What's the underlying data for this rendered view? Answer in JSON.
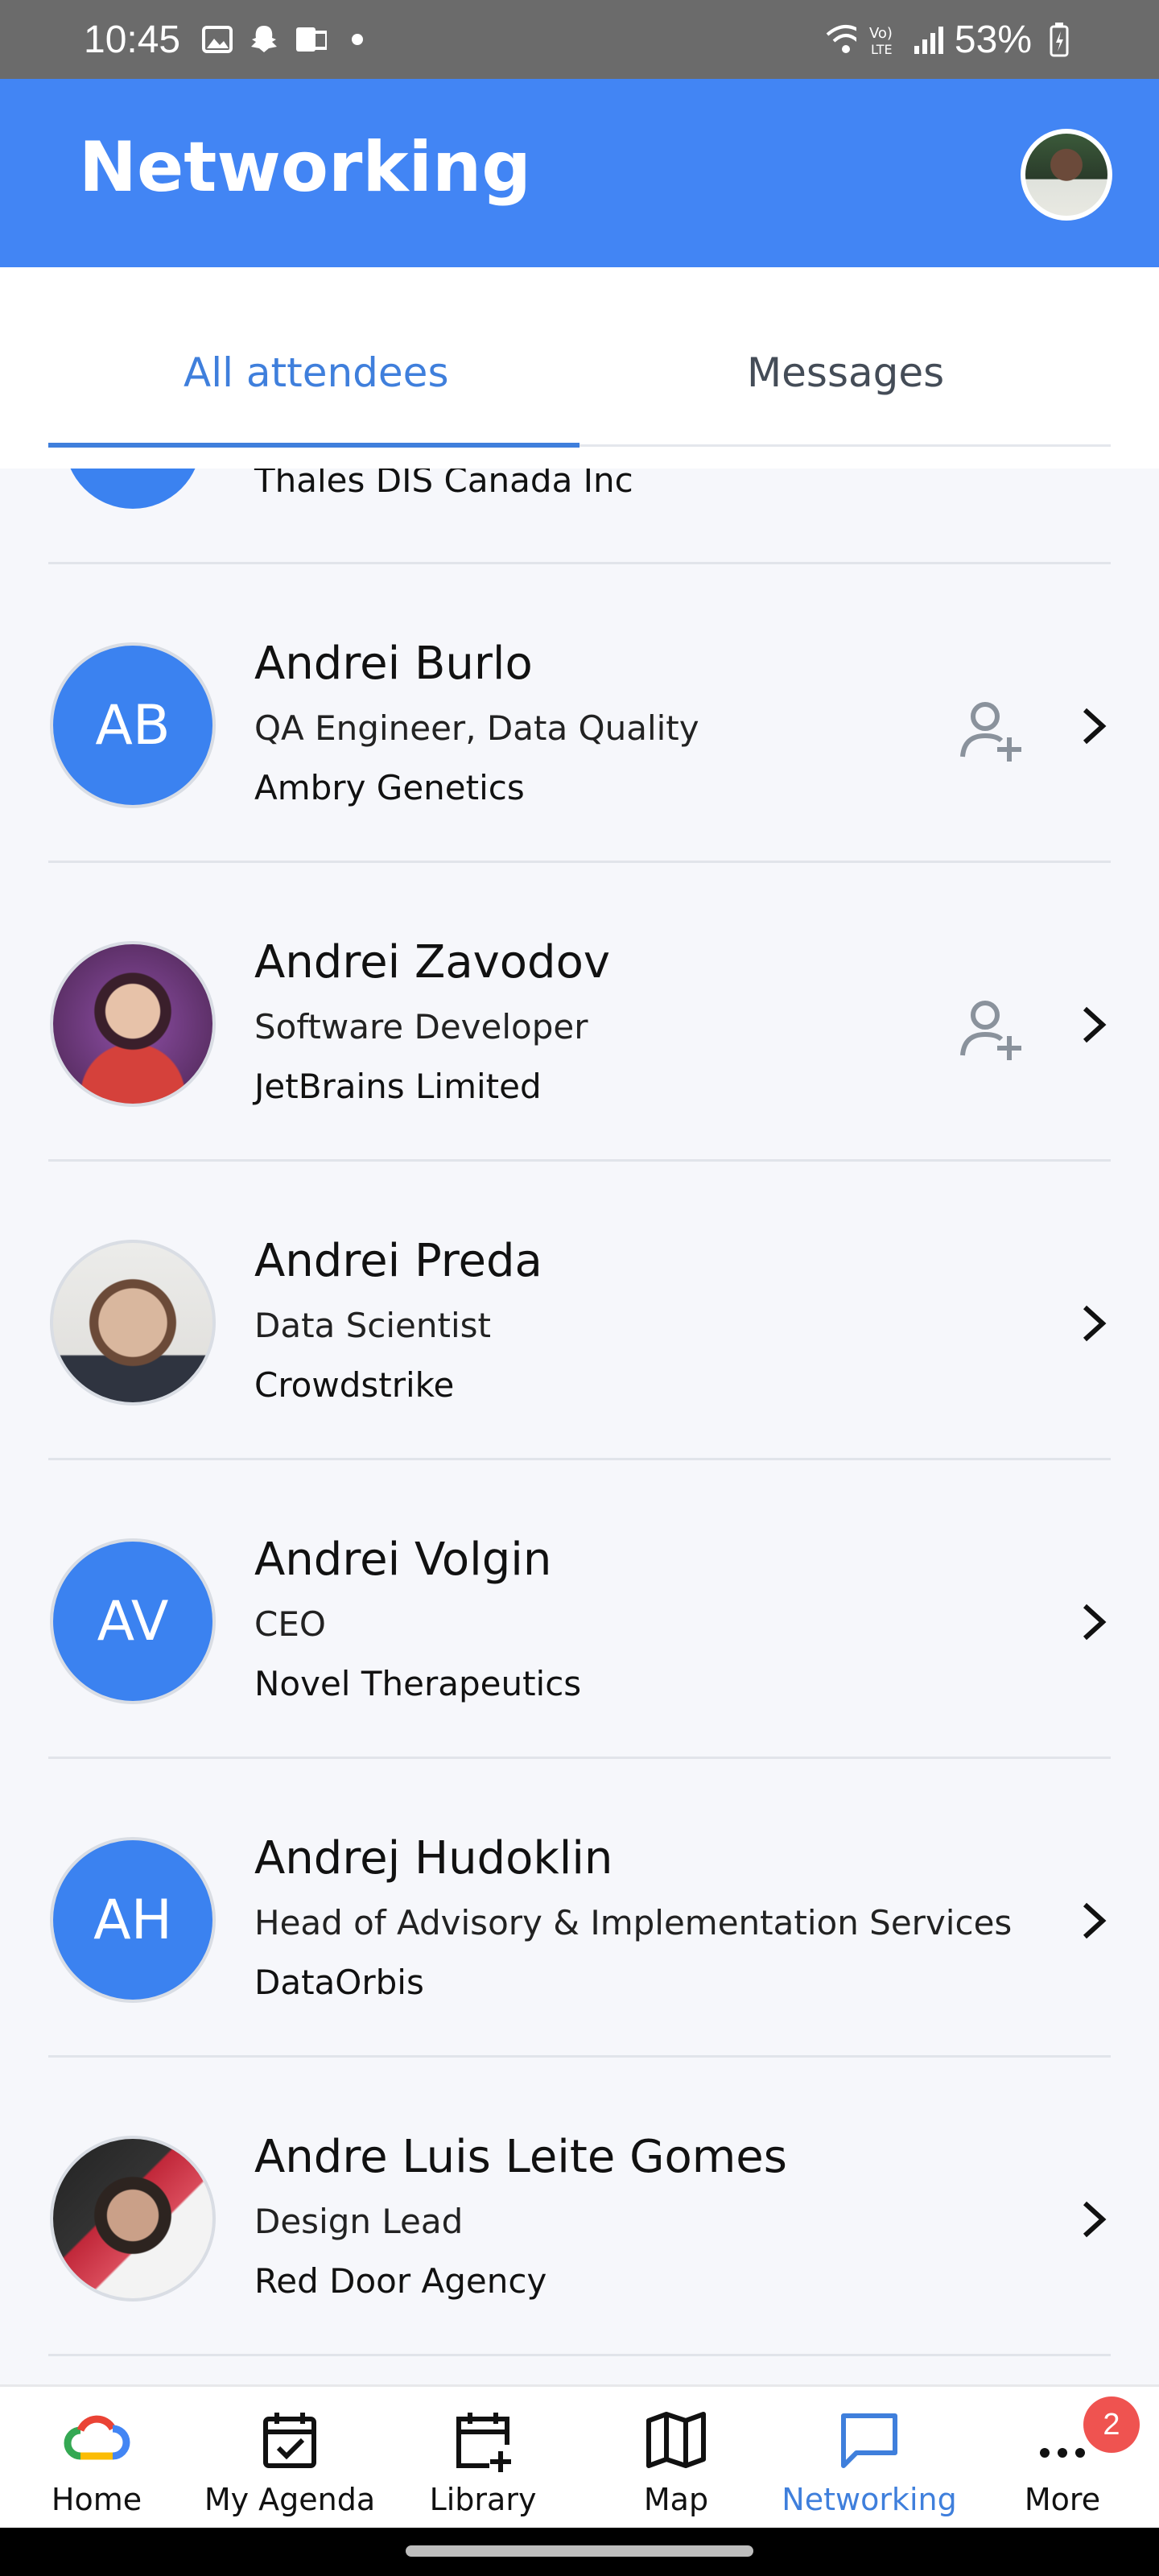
{
  "status_bar": {
    "time": "10:45",
    "battery": "53%"
  },
  "header": {
    "title": "Networking"
  },
  "tabs": [
    {
      "label": "All attendees"
    },
    {
      "label": "Messages"
    }
  ],
  "partial_item": {
    "company": "Thales DIS Canada Inc"
  },
  "attendees": [
    {
      "name": "Andrei Burlo",
      "title": "QA Engineer, Data Quality",
      "company": "Ambry Genetics",
      "initials": "AB"
    },
    {
      "name": "Andrei Zavodov",
      "title": "Software Developer",
      "company": "JetBrains Limited"
    },
    {
      "name": "Andrei Preda",
      "title": "Data Scientist",
      "company": "Crowdstrike"
    },
    {
      "name": "Andrei Volgin",
      "title": "CEO",
      "company": "Novel Therapeutics",
      "initials": "AV"
    },
    {
      "name": "Andrej Hudoklin",
      "title": "Head of Advisory & Implementation Services",
      "company": "DataOrbis",
      "initials": "AH"
    },
    {
      "name": "Andre Luis Leite Gomes",
      "title": "Design Lead",
      "company": "Red Door Agency"
    }
  ],
  "bottom_nav": [
    {
      "label": "Home",
      "icon": "google-cloud-icon"
    },
    {
      "label": "My Agenda",
      "icon": "calendar-check-icon"
    },
    {
      "label": "Library",
      "icon": "calendar-add-icon"
    },
    {
      "label": "Map",
      "icon": "map-icon"
    },
    {
      "label": "Networking",
      "icon": "chat-icon"
    },
    {
      "label": "More",
      "icon": "more-icon",
      "badge": "2"
    }
  ],
  "colors": {
    "primary": "#4285f4",
    "accent": "#3f7fdc",
    "badge": "#ef5350"
  }
}
